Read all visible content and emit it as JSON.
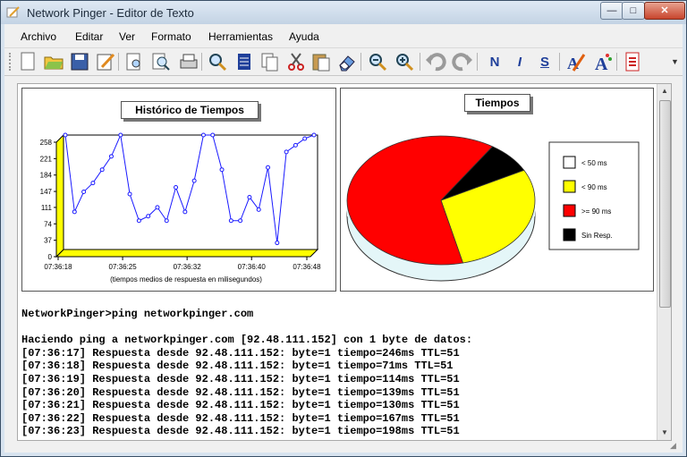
{
  "window": {
    "title": "Network Pinger - Editor de Texto"
  },
  "controls": {
    "minimize": "—",
    "maximize": "□",
    "close": "✕"
  },
  "menu": [
    "Archivo",
    "Editar",
    "Ver",
    "Formato",
    "Herramientas",
    "Ayuda"
  ],
  "toolbar": {
    "buttons": [
      {
        "name": "new-document-icon"
      },
      {
        "name": "open-folder-icon"
      },
      {
        "name": "save-icon"
      },
      {
        "name": "edit-icon"
      },
      {
        "name": "print-preview-icon"
      },
      {
        "name": "find-icon"
      },
      {
        "name": "print-icon"
      },
      {
        "name": "find-replace-icon"
      },
      {
        "name": "copy-list-icon"
      },
      {
        "name": "copy-icon"
      },
      {
        "name": "cut-icon"
      },
      {
        "name": "paste-icon"
      },
      {
        "name": "eraser-icon"
      },
      {
        "name": "zoom-out-icon"
      },
      {
        "name": "zoom-in-icon"
      },
      {
        "name": "undo-icon"
      },
      {
        "name": "redo-icon"
      },
      {
        "name": "bold-icon",
        "label": "N"
      },
      {
        "name": "italic-icon",
        "label": "I"
      },
      {
        "name": "underline-icon",
        "label": "S"
      },
      {
        "name": "text-color-icon"
      },
      {
        "name": "font-icon"
      },
      {
        "name": "document-red-icon"
      }
    ]
  },
  "chart_data": [
    {
      "type": "line",
      "title": "Histórico de Tiempos",
      "xlabel": "(tiempos medios de respuesta en milisegundos)",
      "y_ticks": [
        "258",
        "221",
        "184",
        "147",
        "111",
        "74",
        "37",
        "0"
      ],
      "x_ticks": [
        "07:36:18",
        "07:36:25",
        "07:36:32",
        "07:36:40",
        "07:36:48"
      ],
      "ylim": [
        0,
        258
      ],
      "values": [
        258,
        85,
        130,
        150,
        180,
        210,
        258,
        125,
        65,
        75,
        95,
        65,
        140,
        85,
        155,
        270,
        270,
        180,
        65,
        65,
        118,
        90,
        185,
        15,
        220,
        235,
        250,
        262
      ],
      "colors": {
        "line": "#1a1aff",
        "marker": "#1a1aff",
        "plot_bg": "#ffffff",
        "floor": "#ffff00"
      }
    },
    {
      "type": "pie",
      "title": "Tiempos",
      "legend": [
        "< 50 ms",
        "< 90 ms",
        ">= 90 ms",
        "Sin Resp."
      ],
      "values": [
        0,
        29,
        63,
        8
      ],
      "colors": [
        "#ffffff",
        "#ffff00",
        "#ff0000",
        "#000000"
      ],
      "legend_position": "right"
    }
  ],
  "console": {
    "lines": [
      "NetworkPinger>ping networkpinger.com",
      "",
      "Haciendo ping a networkpinger.com [92.48.111.152] con 1 byte de datos:",
      "[07:36:17] Respuesta desde 92.48.111.152: byte=1 tiempo=246ms TTL=51",
      "[07:36:18] Respuesta desde 92.48.111.152: byte=1 tiempo=71ms TTL=51",
      "[07:36:19] Respuesta desde 92.48.111.152: byte=1 tiempo=114ms TTL=51",
      "[07:36:20] Respuesta desde 92.48.111.152: byte=1 tiempo=139ms TTL=51",
      "[07:36:21] Respuesta desde 92.48.111.152: byte=1 tiempo=130ms TTL=51",
      "[07:36:22] Respuesta desde 92.48.111.152: byte=1 tiempo=167ms TTL=51",
      "[07:36:23] Respuesta desde 92.48.111.152: byte=1 tiempo=198ms TTL=51"
    ]
  }
}
